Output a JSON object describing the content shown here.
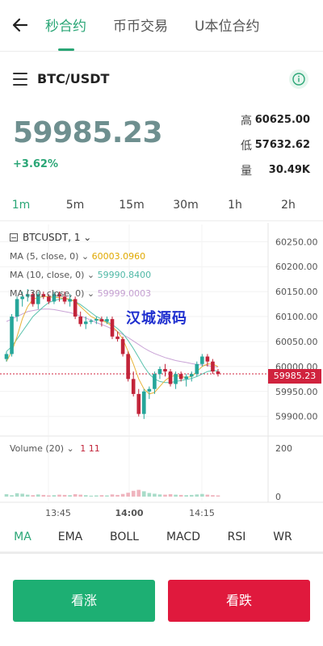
{
  "header": {
    "tabs": [
      "秒合约",
      "币币交易",
      "U本位合约"
    ],
    "active_tab": 0,
    "colors": {
      "accent": "#2aa676"
    }
  },
  "pair": {
    "title": "BTC/USDT"
  },
  "ticker": {
    "price": "59985.23",
    "change": "+3.62%",
    "stats": [
      {
        "label": "高",
        "value": "60625.00"
      },
      {
        "label": "低",
        "value": "57632.62"
      },
      {
        "label": "量",
        "value": "30.49K"
      }
    ]
  },
  "intervals": {
    "items": [
      "1m",
      "5m",
      "15m",
      "30m",
      "1h",
      "2h"
    ],
    "active": 0
  },
  "chart": {
    "symbol_label": "BTCUSDT, 1",
    "ma5_label": "MA (5, close, 0)",
    "ma5_value": "60003.0960",
    "ma10_label": "MA (10, close, 0)",
    "ma10_value": "59990.8400",
    "ma30_label": "MA (30, close, 0)",
    "ma30_value": "59999.0003",
    "volume_label": "Volume (20)",
    "volume_value": "1 11",
    "watermark": "汉城源码",
    "current_price_tag": "59985.23",
    "colors": {
      "up": "#26a69a",
      "down": "#c2243a",
      "ma5": "#e8b339",
      "ma10": "#59c2ad",
      "ma30": "#c9a3d6"
    }
  },
  "chart_data": {
    "type": "candlestick",
    "price_axis": [
      "60250.00",
      "60200.00",
      "60150.00",
      "60100.00",
      "60050.00",
      "60000.00",
      "59950.00",
      "59900.00"
    ],
    "volume_axis": [
      "200",
      "0"
    ],
    "time_axis": [
      "13:45",
      "14:00",
      "14:15"
    ],
    "ylim": [
      59885,
      60265
    ],
    "candles": [
      [
        60015,
        60030,
        60010,
        60025
      ],
      [
        60025,
        60105,
        60020,
        60100
      ],
      [
        60100,
        60140,
        60090,
        60135
      ],
      [
        60135,
        60150,
        60120,
        60140
      ],
      [
        60140,
        60155,
        60130,
        60145
      ],
      [
        60145,
        60150,
        60120,
        60125
      ],
      [
        60125,
        60150,
        60115,
        60145
      ],
      [
        60145,
        60150,
        60135,
        60140
      ],
      [
        60140,
        60145,
        60125,
        60130
      ],
      [
        60130,
        60150,
        60125,
        60145
      ],
      [
        60145,
        60150,
        60130,
        60140
      ],
      [
        60140,
        60150,
        60125,
        60130
      ],
      [
        60130,
        60145,
        60120,
        60135
      ],
      [
        60135,
        60140,
        60095,
        60100
      ],
      [
        60100,
        60110,
        60080,
        60085
      ],
      [
        60085,
        60100,
        60075,
        60090
      ],
      [
        60090,
        60095,
        60085,
        60092
      ],
      [
        60092,
        60100,
        60085,
        60095
      ],
      [
        60095,
        60100,
        60080,
        60090
      ],
      [
        60090,
        60100,
        60085,
        60095
      ],
      [
        60095,
        60100,
        60055,
        60060
      ],
      [
        60060,
        60070,
        60050,
        60055
      ],
      [
        60055,
        60060,
        60020,
        60025
      ],
      [
        60025,
        60030,
        59970,
        59975
      ],
      [
        59975,
        59990,
        59940,
        59945
      ],
      [
        59945,
        59955,
        59900,
        59905
      ],
      [
        59905,
        59955,
        59895,
        59950
      ],
      [
        59950,
        59960,
        59935,
        59955
      ],
      [
        59955,
        59990,
        59945,
        59985
      ],
      [
        59985,
        60000,
        59975,
        59995
      ],
      [
        59995,
        60005,
        59980,
        59990
      ],
      [
        59990,
        59995,
        59960,
        59965
      ],
      [
        59965,
        59990,
        59955,
        59985
      ],
      [
        59985,
        59990,
        59970,
        59975
      ],
      [
        59975,
        59985,
        59960,
        59980
      ],
      [
        59980,
        59990,
        59970,
        59985
      ],
      [
        59985,
        60010,
        59980,
        60005
      ],
      [
        60005,
        60025,
        60000,
        60020
      ],
      [
        60020,
        60025,
        60000,
        60010
      ],
      [
        60010,
        60015,
        59985,
        59990
      ],
      [
        59990,
        59995,
        59980,
        59985
      ]
    ],
    "ma5": [
      60010,
      60030,
      60060,
      60095,
      60120,
      60135,
      60138,
      60140,
      60140,
      60138,
      60138,
      60136,
      60135,
      60130,
      60120,
      60110,
      60100,
      60095,
      60092,
      60088,
      60080,
      60070,
      60055,
      60030,
      60005,
      59975,
      59955,
      59945,
      59948,
      59960,
      59972,
      59980,
      59982,
      59980,
      59978,
      59980,
      59990,
      60000,
      60005,
      60005,
      60000
    ],
    "ma10": [
      60030,
      60040,
      60055,
      60070,
      60085,
      60100,
      60110,
      60120,
      60128,
      60132,
      60135,
      60136,
      60134,
      60130,
      60124,
      60116,
      60108,
      60100,
      60095,
      60090,
      60084,
      60076,
      60066,
      60052,
      60036,
      60018,
      60000,
      59985,
      59975,
      59970,
      59968,
      59968,
      59970,
      59972,
      59974,
      59976,
      59980,
      59985,
      59990,
      59992,
      59991
    ],
    "ma30": [
      60090,
      60095,
      60100,
      60105,
      60110,
      60112,
      60114,
      60115,
      60115,
      60114,
      60112,
      60110,
      60108,
      60105,
      60101,
      60097,
      60093,
      60088,
      60084,
      60080,
      60075,
      60070,
      60064,
      60058,
      60051,
      60044,
      60037,
      60031,
      60026,
      60022,
      60018,
      60015,
      60012,
      60010,
      60008,
      60006,
      60004,
      60003,
      60002,
      60000,
      59999
    ],
    "volume": [
      10,
      6,
      14,
      12,
      8,
      6,
      9,
      7,
      5,
      6,
      8,
      7,
      6,
      10,
      8,
      6,
      4,
      5,
      6,
      5,
      9,
      7,
      11,
      16,
      24,
      28,
      22,
      15,
      12,
      9,
      8,
      10,
      8,
      7,
      6,
      7,
      9,
      11,
      8,
      6,
      5
    ],
    "volume_max": 200
  },
  "indicators": {
    "items": [
      "MA",
      "EMA",
      "BOLL",
      "MACD",
      "RSI",
      "WR"
    ],
    "active": 0
  },
  "actions": {
    "buy_label": "看涨",
    "sell_label": "看跌"
  }
}
